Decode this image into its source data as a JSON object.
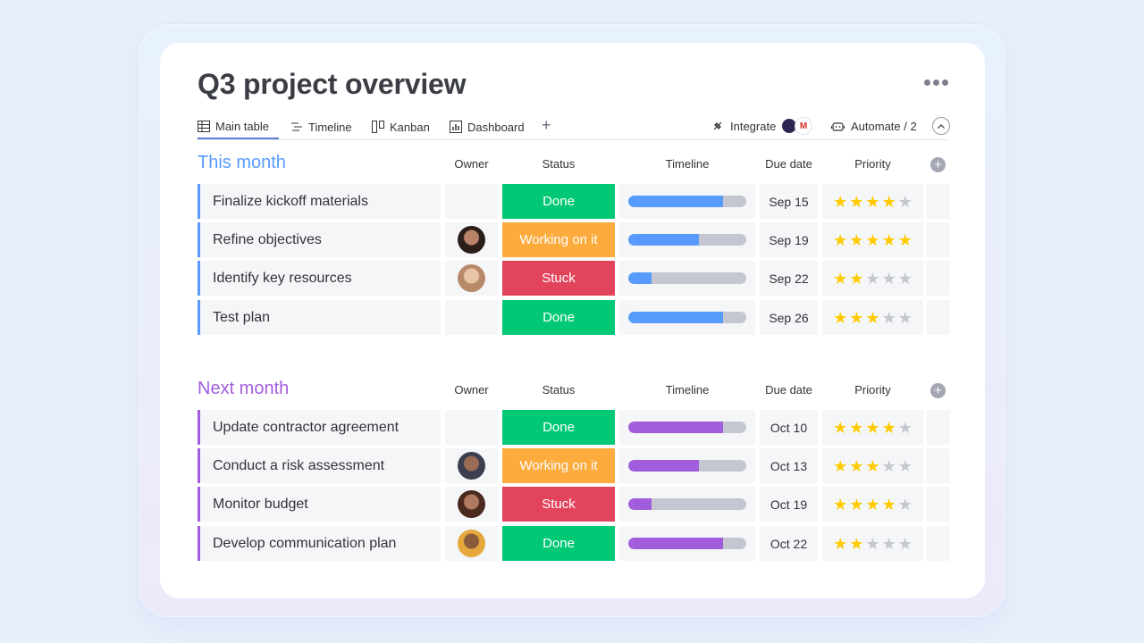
{
  "page": {
    "title": "Q3 project overview"
  },
  "tabs": [
    {
      "label": "Main table",
      "icon": "table-icon"
    },
    {
      "label": "Timeline",
      "icon": "timeline-icon"
    },
    {
      "label": "Kanban",
      "icon": "kanban-icon"
    },
    {
      "label": "Dashboard",
      "icon": "dashboard-icon"
    }
  ],
  "toolbar": {
    "integrate_label": "Integrate",
    "gmail_letter": "M",
    "automate_label": "Automate / 2"
  },
  "columns": {
    "owner": "Owner",
    "status": "Status",
    "timeline": "Timeline",
    "due": "Due date",
    "priority": "Priority"
  },
  "colors": {
    "done": "#00c875",
    "working": "#fdab3d",
    "stuck": "#e2445c",
    "this_month": "#579bfc",
    "next_month": "#a25ddc",
    "star_on": "#ffcb00",
    "star_off": "#c5c7d0"
  },
  "groups": [
    {
      "title": "This month",
      "color": "#579bfc",
      "items": [
        {
          "name": "Finalize kickoff materials",
          "owner": "",
          "status": "Done",
          "progress": 0.8,
          "due": "Sep 15",
          "priority": 4
        },
        {
          "name": "Refine objectives",
          "owner": "avatar-woman-dark-hair",
          "status": "Working on it",
          "progress": 0.6,
          "due": "Sep 19",
          "priority": 5
        },
        {
          "name": "Identify key resources",
          "owner": "avatar-woman-light-hair",
          "status": "Stuck",
          "progress": 0.2,
          "due": "Sep 22",
          "priority": 2
        },
        {
          "name": "Test plan",
          "owner": "",
          "status": "Done",
          "progress": 0.8,
          "due": "Sep 26",
          "priority": 3
        }
      ]
    },
    {
      "title": "Next month",
      "color": "#a25ddc",
      "items": [
        {
          "name": "Update contractor agreement",
          "owner": "",
          "status": "Done",
          "progress": 0.8,
          "due": "Oct 10",
          "priority": 4
        },
        {
          "name": "Conduct a risk assessment",
          "owner": "avatar-man-turban",
          "status": "Working on it",
          "progress": 0.6,
          "due": "Oct 13",
          "priority": 3
        },
        {
          "name": "Monitor budget",
          "owner": "avatar-woman-curly-hair",
          "status": "Stuck",
          "progress": 0.2,
          "due": "Oct 19",
          "priority": 4
        },
        {
          "name": "Develop communication plan",
          "owner": "avatar-man-beard",
          "status": "Done",
          "progress": 0.8,
          "due": "Oct 22",
          "priority": 2
        }
      ]
    }
  ]
}
